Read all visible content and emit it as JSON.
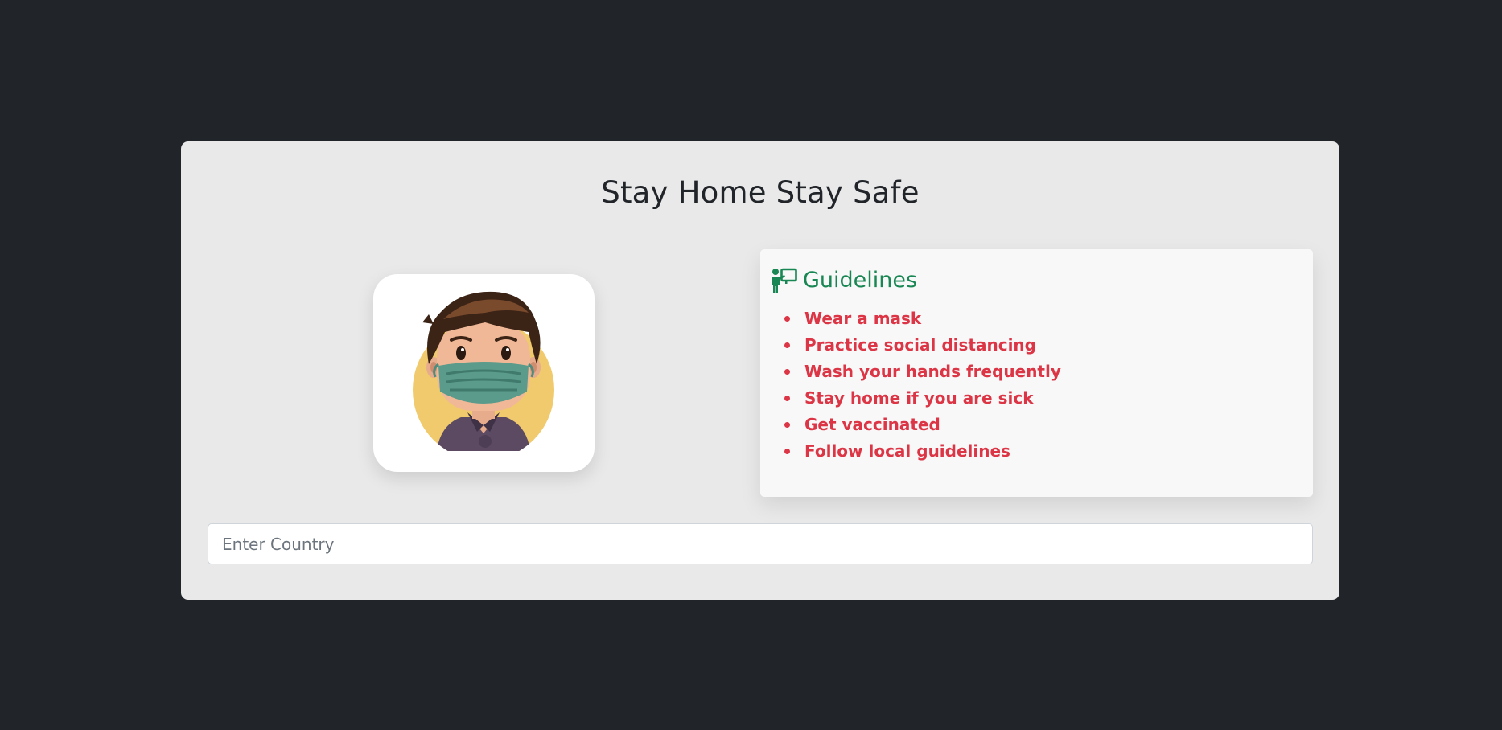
{
  "page": {
    "title": "Stay Home Stay Safe"
  },
  "avatar": {
    "icon": "masked-person-illustration"
  },
  "guidelines": {
    "icon": "teacher-board-icon",
    "title": "Guidelines",
    "items": [
      "Wear a mask",
      "Practice social distancing",
      "Wash your hands frequently",
      "Stay home if you are sick",
      "Get vaccinated",
      "Follow local guidelines"
    ]
  },
  "search": {
    "placeholder": "Enter Country",
    "value": ""
  },
  "colors": {
    "background": "#212529",
    "card": "#e9e9e9",
    "guideline_title": "#198754",
    "guideline_items": "#dc3545"
  }
}
